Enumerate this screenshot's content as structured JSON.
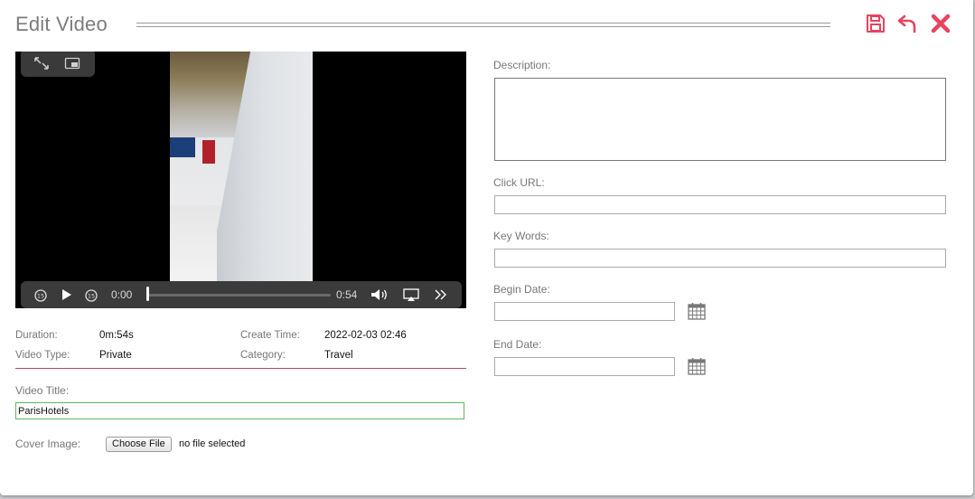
{
  "dialog": {
    "title": "Edit Video"
  },
  "header_icons": [
    "save-icon",
    "undo-icon",
    "close-icon"
  ],
  "colors": {
    "accent": "#e8435f",
    "divider": "#b04a6c",
    "input_focus": "#5cb85c"
  },
  "player": {
    "current_time": "0:00",
    "duration_time": "0:54",
    "progress": 0.0,
    "controls": [
      "fullscreen-icon",
      "picture-in-picture-icon",
      "rewind-15-icon",
      "play-icon",
      "forward-15-icon",
      "volume-icon",
      "airplay-icon",
      "more-icon"
    ]
  },
  "info": {
    "duration_label": "Duration:",
    "duration_value": "0m:54s",
    "create_time_label": "Create Time:",
    "create_time_value": "2022-02-03 02:46",
    "video_type_label": "Video Type:",
    "video_type_value": "Private",
    "category_label": "Category:",
    "category_value": "Travel"
  },
  "form": {
    "video_title_label": "Video Title:",
    "video_title_value": "ParisHotels",
    "cover_image_label": "Cover Image:",
    "choose_file_label": "Choose File",
    "no_file_text": "no file selected",
    "description_label": "Description:",
    "click_url_label": "Click URL:",
    "key_words_label": "Key Words:",
    "begin_date_label": "Begin Date:",
    "end_date_label": "End Date:"
  }
}
